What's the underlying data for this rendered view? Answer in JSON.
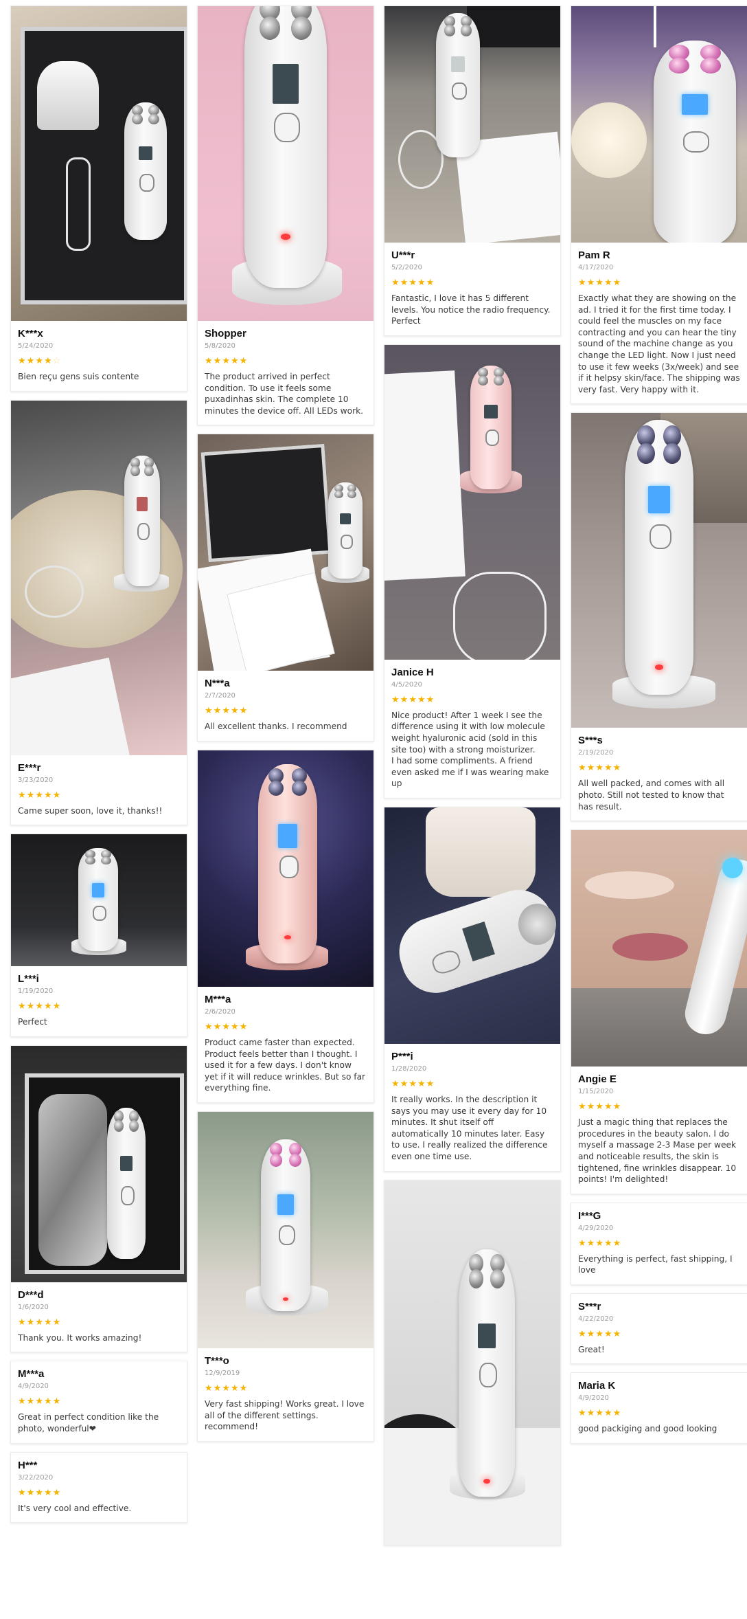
{
  "star_color": "#f5b301",
  "star_full": "★",
  "star_empty": "☆",
  "reviews": [
    {
      "name": "K***x",
      "date": "5/24/2020",
      "rating": 4,
      "text": "Bien reçu gens suis contente"
    },
    {
      "name": "E***r",
      "date": "3/23/2020",
      "rating": 5,
      "text": "Came super soon, love it, thanks!!"
    },
    {
      "name": "L***i",
      "date": "1/19/2020",
      "rating": 5,
      "text": "Perfect"
    },
    {
      "name": "D***d",
      "date": "1/6/2020",
      "rating": 5,
      "text": "Thank you. It works amazing!"
    },
    {
      "name": "M***a",
      "date": "4/9/2020",
      "rating": 5,
      "text": "Great in perfect condition like the photo, wonderful❤"
    },
    {
      "name": "H***",
      "date": "3/22/2020",
      "rating": 5,
      "text": "It's very cool and effective."
    },
    {
      "name": "Shopper",
      "date": "5/8/2020",
      "rating": 5,
      "text": "The product arrived in perfect condition. To use it feels some puxadinhas skin. The complete 10 minutes the device off. All LEDs work."
    },
    {
      "name": "N***a",
      "date": "2/7/2020",
      "rating": 5,
      "text": "All excellent thanks. I recommend"
    },
    {
      "name": "M***a",
      "date": "2/6/2020",
      "rating": 5,
      "text": "Product came faster than expected. Product feels better than I thought. I used it for a few days. I don't know yet if it will reduce wrinkles. But so far everything fine."
    },
    {
      "name": "T***o",
      "date": "12/9/2019",
      "rating": 5,
      "text": "Very fast shipping! Works great. I love all of the different settings. recommend!"
    },
    {
      "name": "U***r",
      "date": "5/2/2020",
      "rating": 5,
      "text": "Fantastic, I love it has 5 different levels. You notice the radio frequency. Perfect"
    },
    {
      "name": "Janice H",
      "date": "4/5/2020",
      "rating": 5,
      "text": "Nice product! After 1 week I see the difference using it with low molecule weight hyaluronic acid (sold  in this site too) with a strong moisturizer.\nI had some compliments. A friend even asked me if I was wearing make up"
    },
    {
      "name": "P***i",
      "date": "1/28/2020",
      "rating": 5,
      "text": "It really works. In the description it says you may use it every day for 10 minutes. It shut itself off automatically 10 minutes later. Easy to use. I really realized the difference even one time use."
    },
    {
      "name": "Pam R",
      "date": "4/17/2020",
      "rating": 5,
      "text": "Exactly what they are showing on the ad. I tried it for the first time today. I could feel the muscles on my face contracting and you can hear the tiny sound of the machine change as you change the LED light. Now I just need to use it few weeks (3x/week) and see if it helpsy skin/face. The shipping was very fast. Very happy with it."
    },
    {
      "name": "S***s",
      "date": "2/19/2020",
      "rating": 5,
      "text": "All well packed, and comes with all photo. Still not tested to know that has result."
    },
    {
      "name": "Angie E",
      "date": "1/15/2020",
      "rating": 5,
      "text": "Just a magic thing that replaces the procedures in the beauty salon. I do myself a massage 2-3 Mase per week and noticeable results, the skin is tightened, fine wrinkles disappear. 10 points! I'm delighted!"
    },
    {
      "name": "I***G",
      "date": "4/29/2020",
      "rating": 5,
      "text": "Everything is perfect, fast shipping, I love"
    },
    {
      "name": "S***r",
      "date": "4/22/2020",
      "rating": 5,
      "text": "Great!"
    },
    {
      "name": "Maria K",
      "date": "4/9/2020",
      "rating": 5,
      "text": "good packiging and good looking"
    }
  ]
}
